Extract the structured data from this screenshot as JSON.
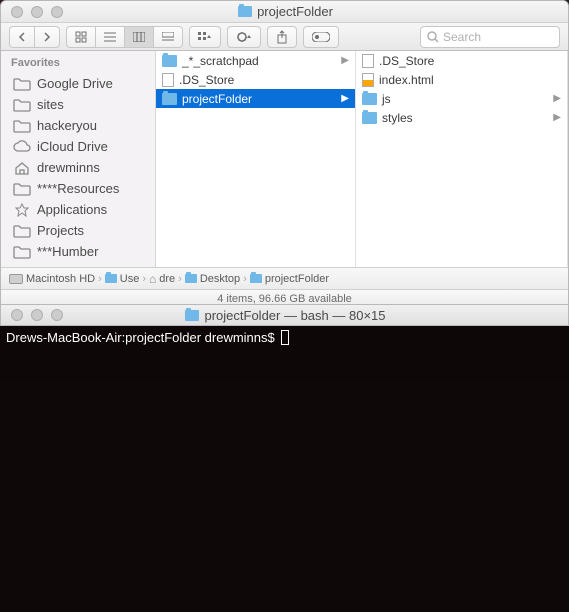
{
  "finder": {
    "title": "projectFolder",
    "search_placeholder": "Search",
    "sidebar": {
      "header": "Favorites",
      "items": [
        {
          "label": "Google Drive",
          "icon": "folder"
        },
        {
          "label": "sites",
          "icon": "folder"
        },
        {
          "label": "hackeryou",
          "icon": "folder"
        },
        {
          "label": "iCloud Drive",
          "icon": "cloud"
        },
        {
          "label": "drewminns",
          "icon": "home"
        },
        {
          "label": "****Resources",
          "icon": "folder"
        },
        {
          "label": "Applications",
          "icon": "app"
        },
        {
          "label": "Projects",
          "icon": "folder"
        },
        {
          "label": "***Humber",
          "icon": "folder"
        }
      ]
    },
    "col1": [
      {
        "name": "_*_scratchpad",
        "type": "folder",
        "arrow": true
      },
      {
        "name": ".DS_Store",
        "type": "file"
      },
      {
        "name": "projectFolder",
        "type": "folder",
        "arrow": true,
        "selected": true
      }
    ],
    "col2": [
      {
        "name": ".DS_Store",
        "type": "file"
      },
      {
        "name": "index.html",
        "type": "html"
      },
      {
        "name": "js",
        "type": "folder",
        "arrow": true
      },
      {
        "name": "styles",
        "type": "folder",
        "arrow": true
      }
    ],
    "path": [
      "Macintosh HD",
      "Use",
      "dre",
      "Desktop",
      "projectFolder"
    ],
    "status": "4 items, 96.66 GB available"
  },
  "terminal": {
    "title": "projectFolder — bash — 80×15",
    "prompt": "Drews-MacBook-Air:projectFolder drewminns$"
  }
}
